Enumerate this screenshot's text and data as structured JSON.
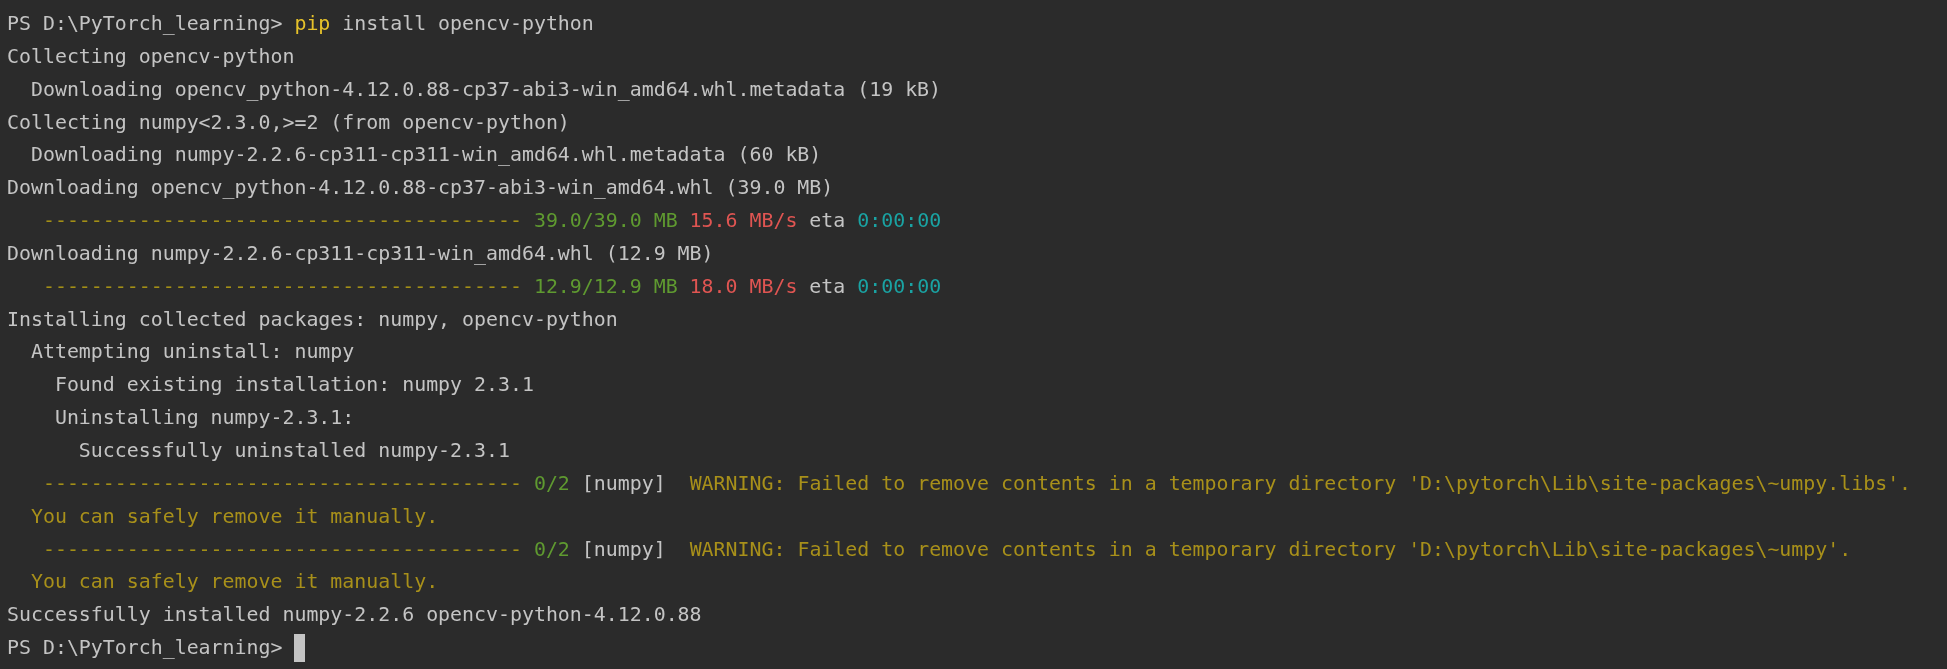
{
  "terminal": {
    "lines": [
      {
        "segments": [
          {
            "kind": "prompt",
            "text": "PS D:\\PyTorch_learning> "
          },
          {
            "kind": "command",
            "text": "pip"
          },
          {
            "kind": "plain",
            "text": " install opencv-python"
          }
        ]
      },
      {
        "segments": [
          {
            "kind": "plain",
            "text": "Collecting opencv-python"
          }
        ]
      },
      {
        "segments": [
          {
            "kind": "plain",
            "text": "  Downloading opencv_python-4.12.0.88-cp37-abi3-win_amd64.whl.metadata (19 kB)"
          }
        ]
      },
      {
        "segments": [
          {
            "kind": "plain",
            "text": "Collecting numpy<2.3.0,>=2 (from opencv-python)"
          }
        ]
      },
      {
        "segments": [
          {
            "kind": "plain",
            "text": "  Downloading numpy-2.2.6-cp311-cp311-win_amd64.whl.metadata (60 kB)"
          }
        ]
      },
      {
        "segments": [
          {
            "kind": "plain",
            "text": "Downloading opencv_python-4.12.0.88-cp37-abi3-win_amd64.whl (39.0 MB)"
          }
        ]
      },
      {
        "segments": [
          {
            "kind": "bar",
            "text": "   ---------------------------------------- "
          },
          {
            "kind": "done",
            "text": "39.0/39.0 MB "
          },
          {
            "kind": "speed",
            "text": "15.6 MB/s"
          },
          {
            "kind": "plain",
            "text": " eta "
          },
          {
            "kind": "eta",
            "text": "0:00:00"
          }
        ]
      },
      {
        "segments": [
          {
            "kind": "plain",
            "text": "Downloading numpy-2.2.6-cp311-cp311-win_amd64.whl (12.9 MB)"
          }
        ]
      },
      {
        "segments": [
          {
            "kind": "bar",
            "text": "   ---------------------------------------- "
          },
          {
            "kind": "done",
            "text": "12.9/12.9 MB "
          },
          {
            "kind": "speed",
            "text": "18.0 MB/s"
          },
          {
            "kind": "plain",
            "text": " eta "
          },
          {
            "kind": "eta",
            "text": "0:00:00"
          }
        ]
      },
      {
        "segments": [
          {
            "kind": "plain",
            "text": "Installing collected packages: numpy, opencv-python"
          }
        ]
      },
      {
        "segments": [
          {
            "kind": "plain",
            "text": "  Attempting uninstall: numpy"
          }
        ]
      },
      {
        "segments": [
          {
            "kind": "plain",
            "text": "    Found existing installation: numpy 2.3.1"
          }
        ]
      },
      {
        "segments": [
          {
            "kind": "plain",
            "text": "    Uninstalling numpy-2.3.1:"
          }
        ]
      },
      {
        "segments": [
          {
            "kind": "plain",
            "text": "      Successfully uninstalled numpy-2.3.1"
          }
        ]
      },
      {
        "segments": [
          {
            "kind": "bar",
            "text": "   ---------------------------------------- "
          },
          {
            "kind": "done",
            "text": "0/2"
          },
          {
            "kind": "plain",
            "text": " [numpy]  "
          },
          {
            "kind": "warning",
            "text": "WARNING: Failed to remove contents in a temporary directory 'D:\\pytorch\\Lib\\site-packages\\~umpy.libs'."
          }
        ]
      },
      {
        "segments": [
          {
            "kind": "warning",
            "text": "  You can safely remove it manually."
          }
        ]
      },
      {
        "segments": [
          {
            "kind": "bar",
            "text": "   ---------------------------------------- "
          },
          {
            "kind": "done",
            "text": "0/2"
          },
          {
            "kind": "plain",
            "text": " [numpy]  "
          },
          {
            "kind": "warning",
            "text": "WARNING: Failed to remove contents in a temporary directory 'D:\\pytorch\\Lib\\site-packages\\~umpy'."
          }
        ]
      },
      {
        "segments": [
          {
            "kind": "warning",
            "text": "  You can safely remove it manually."
          }
        ]
      },
      {
        "segments": [
          {
            "kind": "plain",
            "text": "Successfully installed numpy-2.2.6 opencv-python-4.12.0.88"
          }
        ]
      },
      {
        "segments": [
          {
            "kind": "prompt",
            "text": "PS D:\\PyTorch_learning> "
          }
        ],
        "cursor": true
      }
    ]
  }
}
